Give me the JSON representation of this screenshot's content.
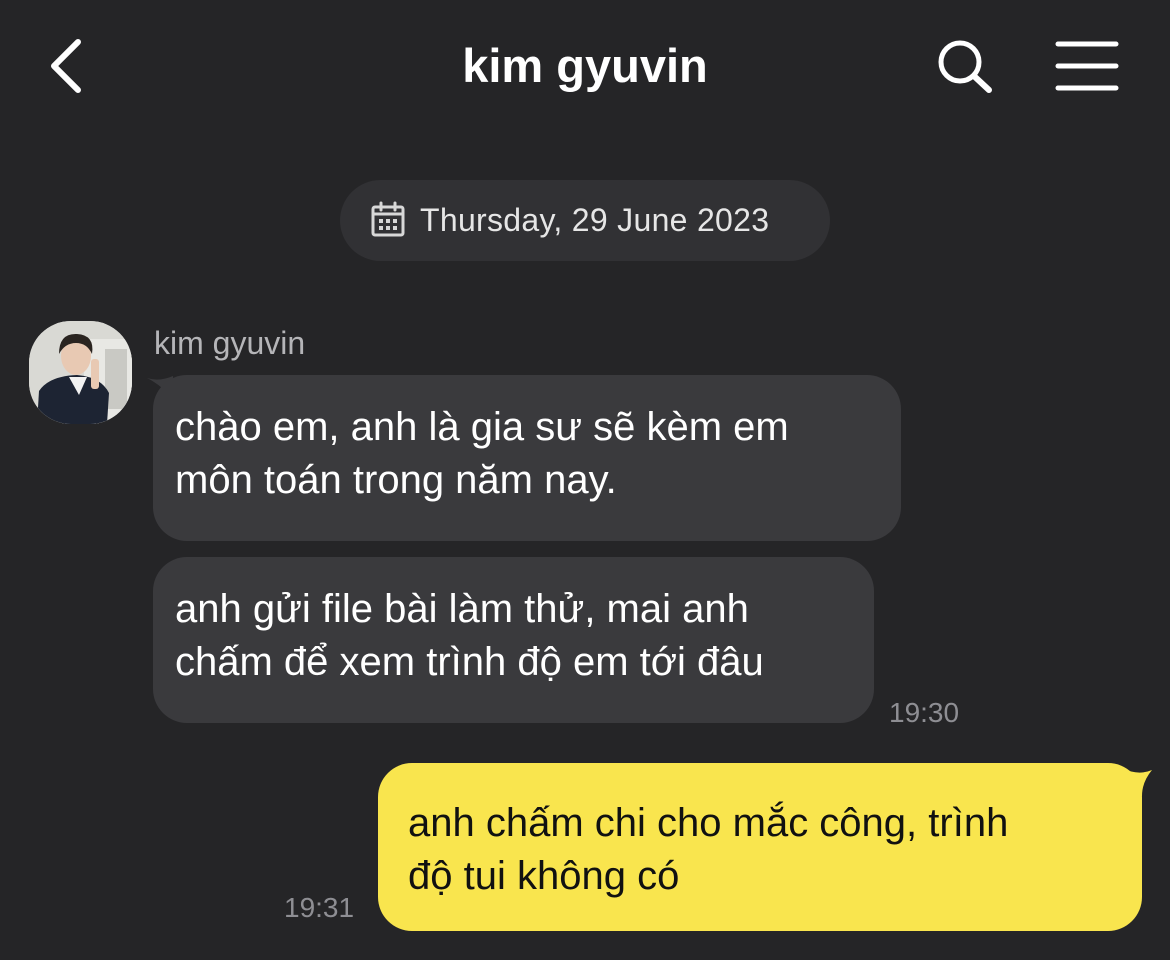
{
  "header": {
    "title": "kim gyuvin",
    "back_icon": "chevron-left-icon",
    "search_icon": "search-icon",
    "menu_icon": "hamburger-menu-icon"
  },
  "date_divider": {
    "icon": "calendar-icon",
    "text": "Thursday, 29 June 2023"
  },
  "incoming": {
    "sender": "kim gyuvin",
    "avatar_icon": "profile-photo",
    "messages": [
      {
        "text": "chào em, anh là gia sư sẽ kèm em\nmôn toán trong năm nay."
      },
      {
        "text": "anh gửi file bài làm thử, mai anh\nchấm để xem trình độ em tới đâu"
      }
    ],
    "time": "19:30"
  },
  "outgoing": {
    "messages": [
      {
        "text": "anh chấm chi cho mắc công, trình\nđộ tui không có"
      }
    ],
    "time": "19:31"
  },
  "colors": {
    "background": "#252527",
    "incoming_bubble": "#3a3a3d",
    "outgoing_bubble": "#f9e54e",
    "date_pill": "#313134",
    "timestamp": "#8e8e93"
  }
}
